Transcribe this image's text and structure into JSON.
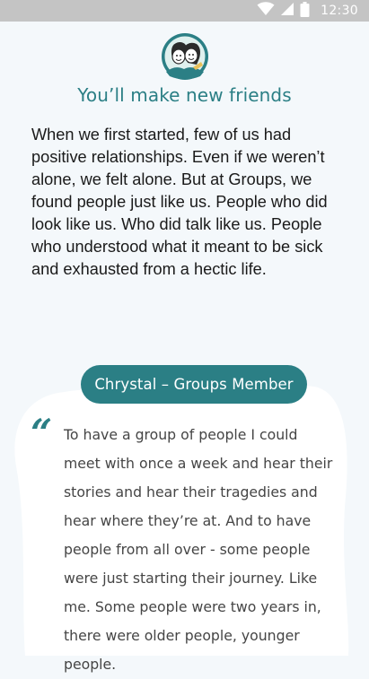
{
  "status_bar": {
    "time": "12:30",
    "icons": [
      "wifi-icon",
      "signal-icon",
      "battery-icon"
    ]
  },
  "avatar": {
    "icon": "friends-illustration-icon"
  },
  "section": {
    "heading": "You’ll make new friends",
    "body": "When we first started, few of us had positive relationships. Even if we weren’t alone, we felt alone. But at Groups, we found people just like us. People who did look like us. Who did talk like us. People who understood what it meant to be sick and exhausted from a hectic life."
  },
  "testimonial": {
    "member_label": "Chrystal – Groups Member",
    "quote_mark": "“",
    "quote": "To have a group of people I could meet with once a week and hear their stories and hear their tragedies and hear where they’re at. And to have people from all over - some people were just starting their journey. Like me. Some people were two years in, there were older people, younger people."
  },
  "colors": {
    "accent": "#2b7f85",
    "background": "#f4f8fb",
    "status_bar": "#c4c4c4"
  }
}
